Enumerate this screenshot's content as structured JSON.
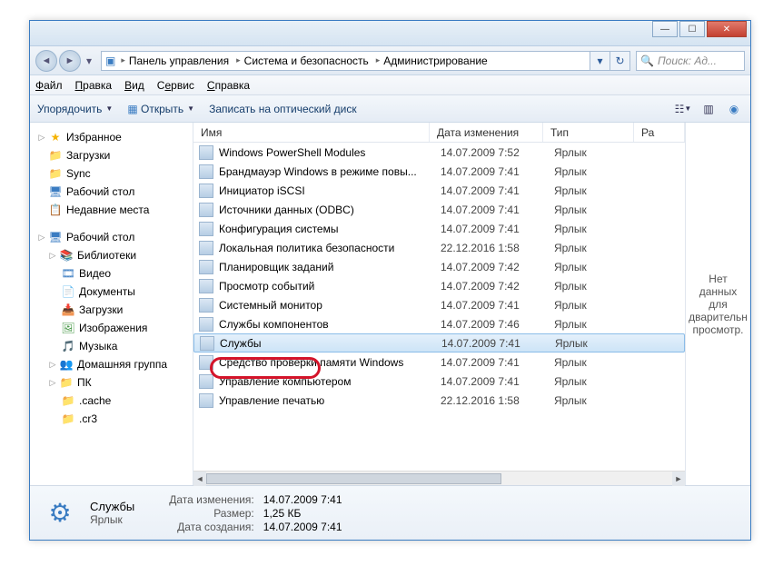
{
  "breadcrumb": {
    "root_icon": "▸",
    "items": [
      "Панель управления",
      "Система и безопасность",
      "Администрирование"
    ]
  },
  "search": {
    "placeholder": "Поиск: Ад..."
  },
  "menubar": {
    "file": "Файл",
    "edit": "Правка",
    "view": "Вид",
    "tools": "Сервис",
    "help": "Справка"
  },
  "toolbar": {
    "organize": "Упорядочить",
    "open": "Открыть",
    "burn": "Записать на оптический диск"
  },
  "columns": {
    "name": "Имя",
    "date": "Дата изменения",
    "type": "Тип",
    "size": "Ра"
  },
  "sidebar": {
    "favorites": {
      "label": "Избранное",
      "items": [
        "Загрузки",
        "Sync",
        "Рабочий стол",
        "Недавние места"
      ]
    },
    "desktop": {
      "label": "Рабочий стол"
    },
    "libraries": {
      "label": "Библиотеки",
      "items": [
        "Видео",
        "Документы",
        "Загрузки",
        "Изображения",
        "Музыка"
      ]
    },
    "homegroup": "Домашняя группа",
    "pc": {
      "label": "ПК",
      "items": [
        ".cache",
        ".cr3"
      ]
    }
  },
  "files": [
    {
      "name": "Windows PowerShell Modules",
      "date": "14.07.2009 7:52",
      "type": "Ярлык"
    },
    {
      "name": "Брандмауэр Windows в режиме повы...",
      "date": "14.07.2009 7:41",
      "type": "Ярлык"
    },
    {
      "name": "Инициатор iSCSI",
      "date": "14.07.2009 7:41",
      "type": "Ярлык"
    },
    {
      "name": "Источники данных (ODBC)",
      "date": "14.07.2009 7:41",
      "type": "Ярлык"
    },
    {
      "name": "Конфигурация системы",
      "date": "14.07.2009 7:41",
      "type": "Ярлык"
    },
    {
      "name": "Локальная политика безопасности",
      "date": "22.12.2016 1:58",
      "type": "Ярлык"
    },
    {
      "name": "Планировщик заданий",
      "date": "14.07.2009 7:42",
      "type": "Ярлык"
    },
    {
      "name": "Просмотр событий",
      "date": "14.07.2009 7:42",
      "type": "Ярлык"
    },
    {
      "name": "Системный монитор",
      "date": "14.07.2009 7:41",
      "type": "Ярлык"
    },
    {
      "name": "Службы компонентов",
      "date": "14.07.2009 7:46",
      "type": "Ярлык"
    },
    {
      "name": "Службы",
      "date": "14.07.2009 7:41",
      "type": "Ярлык",
      "selected": true
    },
    {
      "name": "Средство проверки памяти Windows",
      "date": "14.07.2009 7:41",
      "type": "Ярлык"
    },
    {
      "name": "Управление компьютером",
      "date": "14.07.2009 7:41",
      "type": "Ярлык"
    },
    {
      "name": "Управление печатью",
      "date": "22.12.2016 1:58",
      "type": "Ярлык"
    }
  ],
  "preview": {
    "text": "Нет данных для дварительн просмотр."
  },
  "details": {
    "title": "Службы",
    "subtitle": "Ярлык",
    "date_label": "Дата изменения:",
    "date_value": "14.07.2009 7:41",
    "size_label": "Размер:",
    "size_value": "1,25 КБ",
    "created_label": "Дата создания:",
    "created_value": "14.07.2009 7:41"
  }
}
